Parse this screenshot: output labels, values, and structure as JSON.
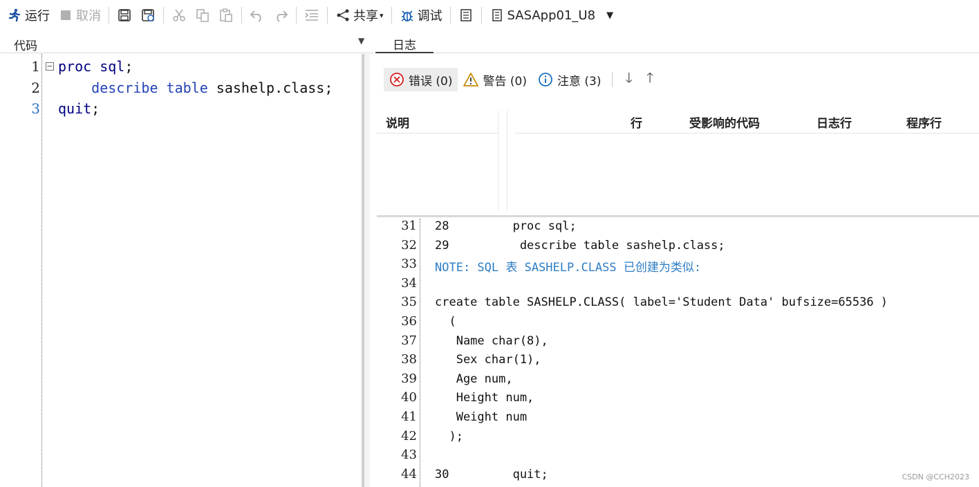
{
  "toolbar": {
    "run": "运行",
    "cancel": "取消",
    "share": "共享",
    "debug": "调试",
    "server": "SASApp01_U8"
  },
  "left_pane": {
    "tab_title": "代码",
    "lines": [
      {
        "num": "1",
        "tokens": [
          {
            "t": "proc sql",
            "c": "kw"
          },
          {
            "t": ";",
            "c": "txt"
          }
        ]
      },
      {
        "num": "2",
        "tokens": [
          {
            "t": "    describe table",
            "c": "kw2"
          },
          {
            "t": " sashelp.class;",
            "c": "txt"
          }
        ]
      },
      {
        "num": "3",
        "tokens": [
          {
            "t": "quit",
            "c": "kw"
          },
          {
            "t": ";",
            "c": "txt"
          }
        ]
      }
    ]
  },
  "right_pane": {
    "tab_title": "日志",
    "filters": {
      "errors": "错误 (0)",
      "warnings": "警告 (0)",
      "notes": "注意 (3)"
    },
    "grid_headers": {
      "desc": "说明",
      "line": "行",
      "affected": "受影响的代码",
      "log_line": "日志行",
      "program_line": "程序行"
    },
    "log_lines": [
      {
        "num": "31",
        "text": "28         proc sql;",
        "note": false
      },
      {
        "num": "32",
        "text": "29          describe table sashelp.class;",
        "note": false
      },
      {
        "num": "33",
        "text": "NOTE: SQL 表 SASHELP.CLASS 已创建为类似:",
        "note": true
      },
      {
        "num": "34",
        "text": "",
        "note": false
      },
      {
        "num": "35",
        "text": "create table SASHELP.CLASS( label='Student Data' bufsize=65536 )",
        "note": false
      },
      {
        "num": "36",
        "text": "  (",
        "note": false
      },
      {
        "num": "37",
        "text": "   Name char(8),",
        "note": false
      },
      {
        "num": "38",
        "text": "   Sex char(1),",
        "note": false
      },
      {
        "num": "39",
        "text": "   Age num,",
        "note": false
      },
      {
        "num": "40",
        "text": "   Height num,",
        "note": false
      },
      {
        "num": "41",
        "text": "   Weight num",
        "note": false
      },
      {
        "num": "42",
        "text": "  );",
        "note": false
      },
      {
        "num": "43",
        "text": "",
        "note": false
      },
      {
        "num": "44",
        "text": "30         quit;",
        "note": false
      }
    ]
  },
  "watermark": "CSDN @CCH2023"
}
